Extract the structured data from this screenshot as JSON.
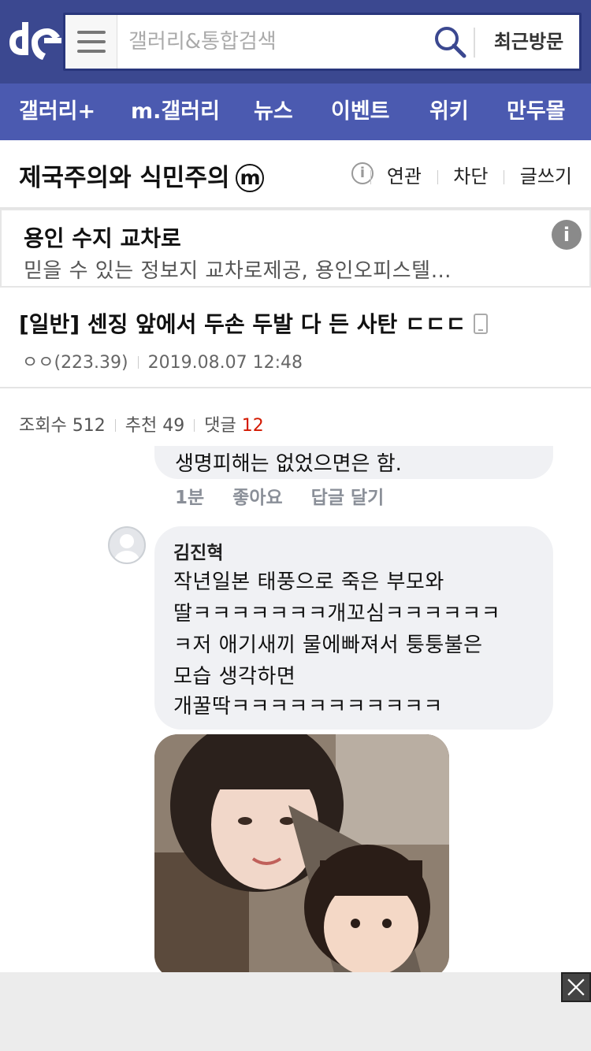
{
  "header": {
    "search_placeholder": "갤러리&통합검색",
    "recent_label": "최근방문",
    "brand_color": "#3b4890"
  },
  "nav": {
    "items": [
      "갤러리+",
      "m.갤러리",
      "뉴스",
      "이벤트",
      "위키",
      "만두몰"
    ]
  },
  "gallery": {
    "title": "제국주의와 식민주의",
    "badge": "m",
    "links": [
      "연관",
      "차단",
      "글쓰기"
    ]
  },
  "ad": {
    "title": "용인 수지 교차로",
    "description": "믿을 수 있는 정보지 교차로제공, 용인오피스텔…"
  },
  "post": {
    "title": "[일반] 센징 앞에서 두손 두발 다 든 사탄 ㄷㄷㄷ",
    "author": "ㅇㅇ(223.39)",
    "date": "2019.08.07 12:48",
    "views_label": "조회수",
    "views": "512",
    "recommend_label": "추천",
    "recommend": "49",
    "comments_label": "댓글",
    "comments": "12"
  },
  "screenshot": {
    "prev_comment_tail": "생명피해는 없었으면은 함.",
    "actions": [
      "1분",
      "좋아요",
      "답글 달기"
    ],
    "comment": {
      "author": "김진혁",
      "lines": [
        "작년일본 태풍으로 죽은 부모와",
        "딸ㅋㅋㅋㅋㅋㅋㅋ개꼬심ㅋㅋㅋㅋㅋㅋ",
        "ㅋ저 애기새끼 물에빠져서 퉁퉁불은",
        "모습 생각하면",
        "개꿀딱ㅋㅋㅋㅋㅋㅋㅋㅋㅋㅋㅋ"
      ]
    }
  }
}
